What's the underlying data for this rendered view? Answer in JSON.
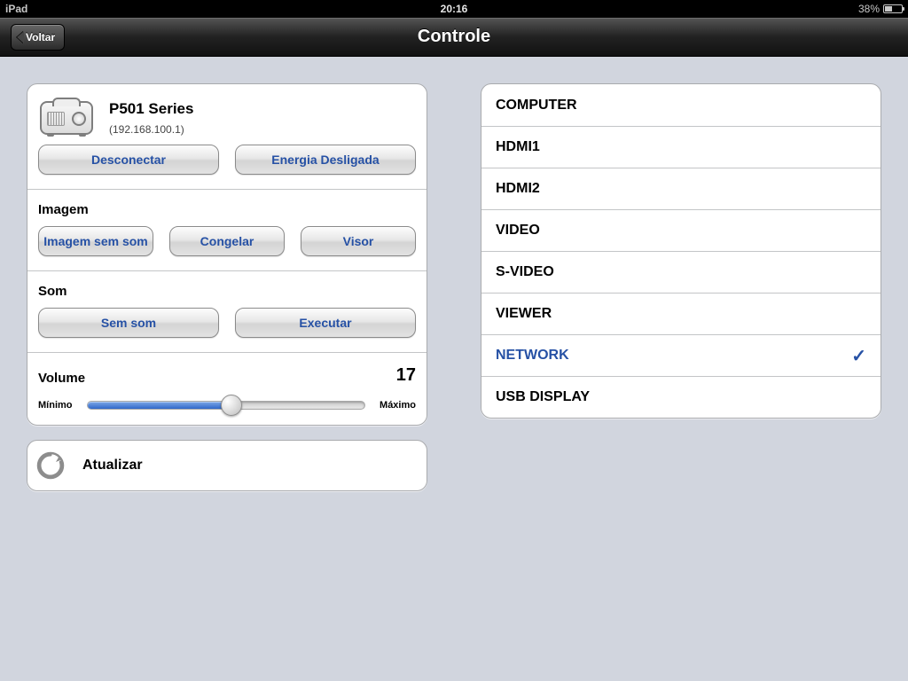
{
  "statusbar": {
    "left": "iPad",
    "time": "20:16",
    "battery_pct": "38%"
  },
  "navbar": {
    "back": "Voltar",
    "title": "Controle"
  },
  "device": {
    "name": "P501 Series",
    "ip": "(192.168.100.1)"
  },
  "actions": {
    "disconnect": "Desconectar",
    "power_off": "Energia Desligada"
  },
  "image_section": {
    "title": "Imagem",
    "mute_image": "Imagem sem som",
    "freeze": "Congelar",
    "viewer": "Visor"
  },
  "sound_section": {
    "title": "Som",
    "mute_sound": "Sem som",
    "play": "Executar"
  },
  "volume": {
    "title": "Volume",
    "value": "17",
    "min_label": "Mínimo",
    "max_label": "Máximo",
    "percent": 52
  },
  "refresh": {
    "label": "Atualizar"
  },
  "sources": {
    "items": [
      "COMPUTER",
      "HDMI1",
      "HDMI2",
      "VIDEO",
      "S-VIDEO",
      "VIEWER",
      "NETWORK",
      "USB DISPLAY"
    ],
    "selected_index": 6
  }
}
